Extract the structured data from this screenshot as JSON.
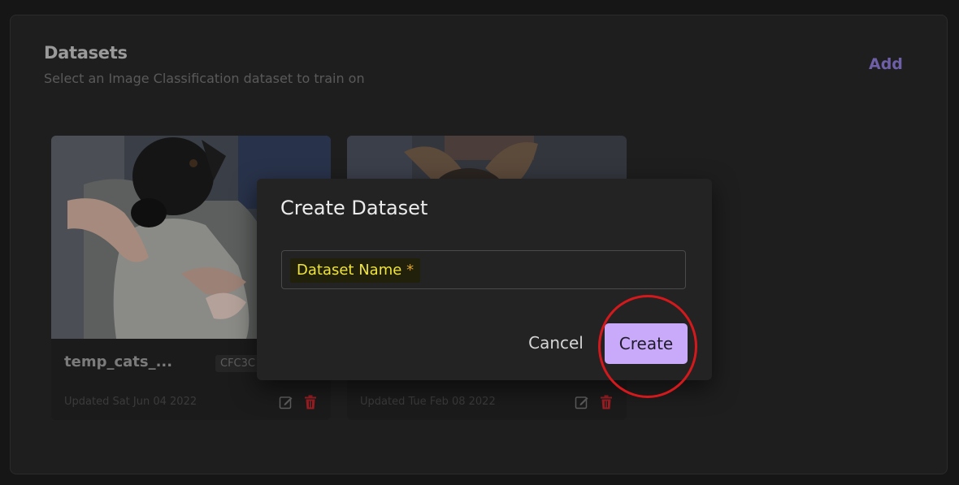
{
  "header": {
    "title": "Datasets",
    "subtitle": "Select an Image Classification dataset to train on",
    "add_label": "Add"
  },
  "cards": [
    {
      "name": "temp_cats_...",
      "tag": "CFC3C",
      "updated": "Updated Sat Jun 04 2022"
    },
    {
      "name": "",
      "tag": "",
      "updated": "Updated Tue Feb 08 2022"
    }
  ],
  "dialog": {
    "title": "Create Dataset",
    "field_label": "Dataset Name",
    "required_mark": "*",
    "cancel_label": "Cancel",
    "create_label": "Create"
  },
  "colors": {
    "accent": "#c9a9f9",
    "add_link": "#6f5fa8",
    "highlight_ring": "#d4191d",
    "field_label": "#f0e43a"
  },
  "icons": [
    "edit-icon",
    "delete-icon"
  ]
}
